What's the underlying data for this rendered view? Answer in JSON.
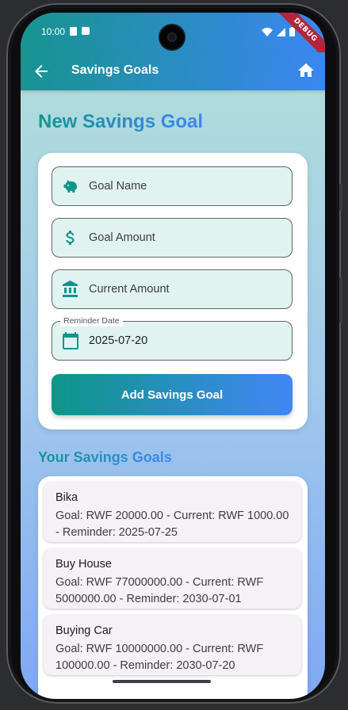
{
  "status_bar": {
    "time": "10:00",
    "debug_label": "DEBUG"
  },
  "app_bar": {
    "title": "Savings Goals",
    "back_icon": "arrow-back-icon",
    "home_icon": "home-icon"
  },
  "form": {
    "heading": "New Savings Goal",
    "goal_name": {
      "placeholder": "Goal Name",
      "icon": "piggy-bank-icon"
    },
    "goal_amount": {
      "placeholder": "Goal Amount",
      "icon": "dollar-icon"
    },
    "current_amount": {
      "placeholder": "Current Amount",
      "icon": "bank-icon"
    },
    "reminder_date": {
      "label": "Reminder Date",
      "value": "2025-07-20",
      "icon": "calendar-icon"
    },
    "submit_label": "Add Savings Goal"
  },
  "goals_section": {
    "heading": "Your Savings Goals",
    "goals": [
      {
        "name": "Bika",
        "details": "Goal: RWF 20000.00 - Current: RWF 1000.00 - Reminder: 2025-07-25"
      },
      {
        "name": "Buy House",
        "details": "Goal: RWF 77000000.00 - Current: RWF 5000000.00 - Reminder: 2030-07-01"
      },
      {
        "name": "Buying Car",
        "details": "Goal: RWF 10000000.00 - Current: RWF 100000.00 - Reminder: 2030-07-20"
      }
    ]
  },
  "colors": {
    "teal": "#17948F",
    "blue": "#3C86F2",
    "field_fill": "#E1F3F1"
  }
}
